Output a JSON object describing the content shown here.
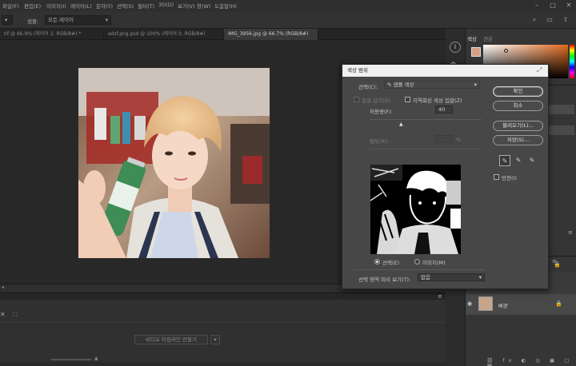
{
  "menu": {
    "items": [
      "파일(F)",
      "편집(E)",
      "이미지(I)",
      "레이어(L)",
      "문자(Y)",
      "선택(S)",
      "필터(T)",
      "3D(D)",
      "보기(V)",
      "창(W)",
      "도움말(H)"
    ]
  },
  "options": {
    "sample_label": "샘플:",
    "sample_value": "모든 레이어"
  },
  "tabs": [
    {
      "label": "tif @ 66.9% (레이어 2, RGB/8#) *"
    },
    {
      "label": "adsf.png.psd @ 100% (레이어 0, RGB/8#)"
    },
    {
      "label": "IMG_3956.jpg @ 66.7% (RGB/8#)"
    }
  ],
  "timeline": {
    "create_label": "비디오 타임라인 만들기"
  },
  "panels": {
    "color_tab": "색상",
    "swatches_tab": "견본",
    "layer_name": "배경"
  },
  "dialog": {
    "title": "색상 범위",
    "select_label": "선택(C):",
    "select_value": "샘플 색상",
    "detect_faces_label": "얼굴 감지(D)",
    "localized_label": "지역화된 색상 집합(Z)",
    "fuzziness_label": "허용량(F):",
    "fuzziness_value": "40",
    "range_label": "범위(R):",
    "range_value": "",
    "range_unit": "%",
    "ok_label": "확인",
    "cancel_label": "취소",
    "load_label": "불러오기(L)...",
    "save_label": "저장(S)...",
    "invert_label": "반전(I)",
    "selection_radio": "선택(E)",
    "image_radio": "이미지(M)",
    "preview_label": "선택 영역 미리 보기(T):",
    "preview_value": "없음"
  }
}
